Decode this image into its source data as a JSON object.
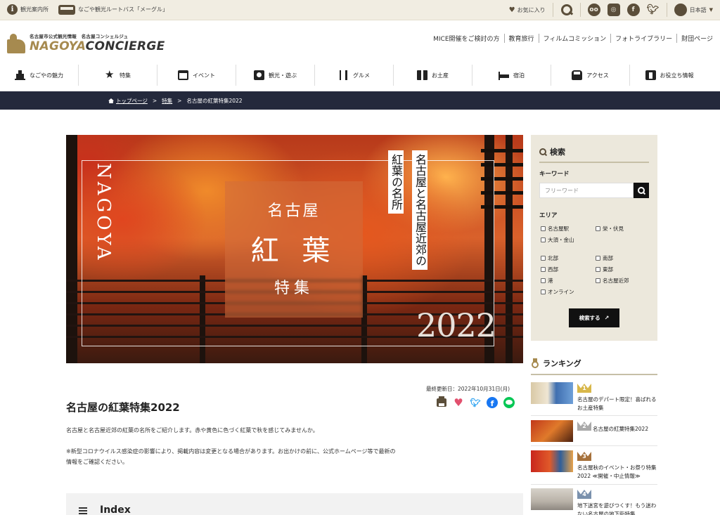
{
  "topbar": {
    "tourist_info": "観光案内所",
    "meguru_bus": "なごや観光ルートバス「メーグル」",
    "favorites": "お気に入り",
    "language": "日本語"
  },
  "header": {
    "logo_sub": "名古屋市公式観光情報　名古屋コンシェルジュ",
    "logo_main_1": "NAGOYA",
    "logo_main_2": "CONCIERGE",
    "links": [
      "MICE開催をご検討の方",
      "教育旅行",
      "フィルムコミッション",
      "フォトライブラリー",
      "財団ページ"
    ]
  },
  "nav": [
    {
      "label": "なごやの魅力",
      "icon": "castle-icon"
    },
    {
      "label": "特集",
      "icon": "star-icon"
    },
    {
      "label": "イベント",
      "icon": "calendar-icon"
    },
    {
      "label": "観光・遊ぶ",
      "icon": "camera-icon"
    },
    {
      "label": "グルメ",
      "icon": "fork-knife-icon"
    },
    {
      "label": "お土産",
      "icon": "gift-icon"
    },
    {
      "label": "宿泊",
      "icon": "bed-icon"
    },
    {
      "label": "アクセス",
      "icon": "train-icon"
    },
    {
      "label": "お役立ち情報",
      "icon": "info-book-icon"
    }
  ],
  "breadcrumb": [
    "トップページ",
    "特集",
    "名古屋の紅葉特集2022"
  ],
  "hero": {
    "nagoya": "NAGOYA",
    "box_line1": "名古屋",
    "box_line2": "紅 葉",
    "box_line3": "特集",
    "vertical_1": "名古屋と名古屋近郊の",
    "vertical_2": "紅葉の名所",
    "year": "2022"
  },
  "article": {
    "updated": "最終更新日：2022年10月31日(月)",
    "title": "名古屋の紅葉特集2022",
    "intro": "名古屋と名古屋近郊の紅葉の名所をご紹介します。赤や黄色に色づく紅葉で秋を感じてみませんか。",
    "notice_1": "※新型コロナウイルス感染症の影響により、掲載内容は変更となる場合があります。お出かけの前に、公式ホームページ等で最新の",
    "notice_2": "情報をご確認ください。",
    "index_title": "Index"
  },
  "search": {
    "heading": "検索",
    "keyword_label": "キーワード",
    "keyword_placeholder": "フリーワード",
    "area_label": "エリア",
    "areas": [
      "名古屋駅",
      "栄・伏見",
      "大須・金山",
      "北部",
      "南部",
      "西部",
      "東部",
      "港",
      "名古屋近郊",
      "オンライン"
    ],
    "submit": "検索する"
  },
  "ranking": {
    "heading": "ランキング",
    "items": [
      {
        "rank": "1",
        "text": "名古屋のデパート限定！喜ばれるお土産特集",
        "crown_color": "#d8b74a"
      },
      {
        "rank": "2",
        "text": "名古屋の紅葉特集2022",
        "crown_color": "#a9a9a9"
      },
      {
        "rank": "3",
        "text": "名古屋秋のイベント・お祭り特集2022 ≪開催・中止情報≫",
        "crown_color": "#a6713b"
      },
      {
        "rank": "4",
        "text": "地下迷宮を遊びつくす！もう迷わない名古屋の地下街特集",
        "crown_color": "#7a91ad"
      }
    ]
  },
  "colors": {
    "brand_gold": "#a68a4f",
    "breadcrumb_bg": "#24293c",
    "topbar_bg": "#f1ede2",
    "sidebar_bg": "#ece8dc"
  }
}
